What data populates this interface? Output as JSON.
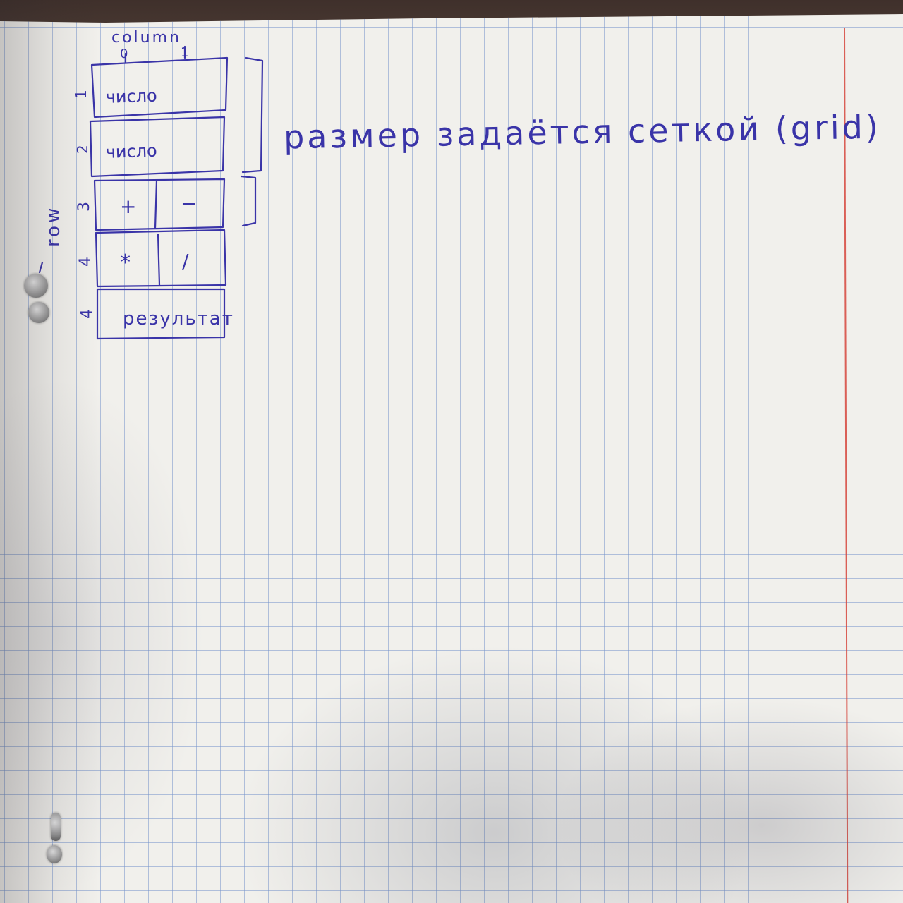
{
  "sketch": {
    "column_label": "column",
    "column_numbers": [
      "0",
      "1"
    ],
    "row_label": "row",
    "row_numbers": [
      "1",
      "2",
      "3",
      "4",
      "4"
    ],
    "cells": {
      "row1": "число",
      "row2": "число",
      "row3_left": "+",
      "row3_right": "−",
      "row4_left": "*",
      "row4_right": "/",
      "row5": "результат"
    },
    "note": "размер задаётся сеткой (grid)"
  },
  "colors": {
    "ink": "#3a34a8",
    "paper": "#f1f0ec",
    "grid_line": "#7896cd",
    "margin_line": "#d6453c",
    "table_background": "#3b2d29"
  }
}
